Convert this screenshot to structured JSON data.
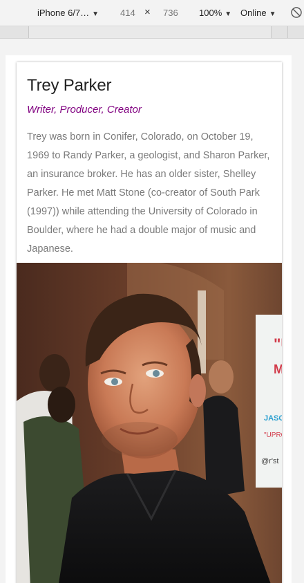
{
  "devtools": {
    "device": "iPhone 6/7…",
    "width": "414",
    "times": "×",
    "height": "736",
    "zoom": "100%",
    "network": "Online",
    "arrow": "▼"
  },
  "profile": {
    "name": "Trey Parker",
    "role": "Writer, Producer, Creator",
    "bio": "Trey was born in Conifer, Colorado, on October 19, 1969 to Randy Parker, a geologist, and Sharon Parker, an insurance broker. He has an older sister, Shelley Parker. He met Matt Stone (co-creator of South Park (1997)) while attending the University of Colorado in Boulder, where he had a double major of music and Japanese.",
    "role_color": "#800080",
    "photo_subject": "portrait photo of Trey Parker in a black shirt"
  }
}
